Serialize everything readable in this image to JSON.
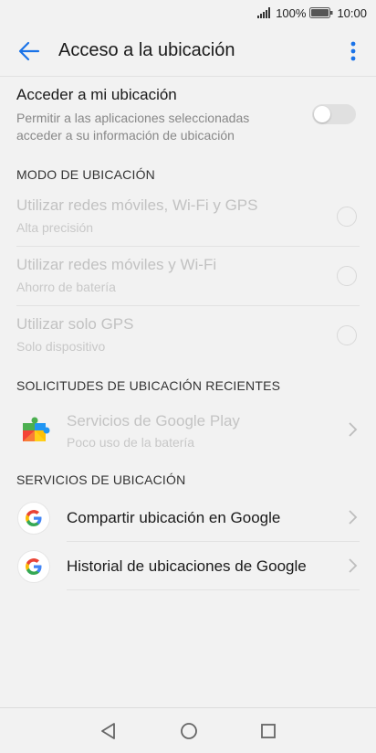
{
  "status": {
    "battery_pct": "100%",
    "time": "10:00"
  },
  "app_bar": {
    "title": "Acceso a la ubicación"
  },
  "access": {
    "title": "Acceder a mi ubicación",
    "subtitle": "Permitir a las aplicaciones seleccionadas acceder a su información de ubicación",
    "enabled": false
  },
  "mode_section": {
    "header": "MODO DE UBICACIÓN",
    "options": [
      {
        "title": "Utilizar redes móviles, Wi-Fi y GPS",
        "subtitle": "Alta precisión"
      },
      {
        "title": "Utilizar redes móviles y Wi-Fi",
        "subtitle": "Ahorro de batería"
      },
      {
        "title": "Utilizar solo GPS",
        "subtitle": "Solo dispositivo"
      }
    ]
  },
  "recent_section": {
    "header": "SOLICITUDES DE UBICACIÓN RECIENTES",
    "apps": [
      {
        "title": "Servicios de Google Play",
        "subtitle": "Poco uso de la batería",
        "icon": "google-play-services-icon"
      }
    ]
  },
  "services_section": {
    "header": "SERVICIOS DE UBICACIÓN",
    "items": [
      {
        "title": "Compartir ubicación en Google",
        "icon": "google-icon"
      },
      {
        "title": "Historial de ubicaciones de Google",
        "icon": "google-icon"
      }
    ]
  },
  "colors": {
    "accent": "#1a73e8",
    "disabled_text": "#c2c2c2"
  }
}
